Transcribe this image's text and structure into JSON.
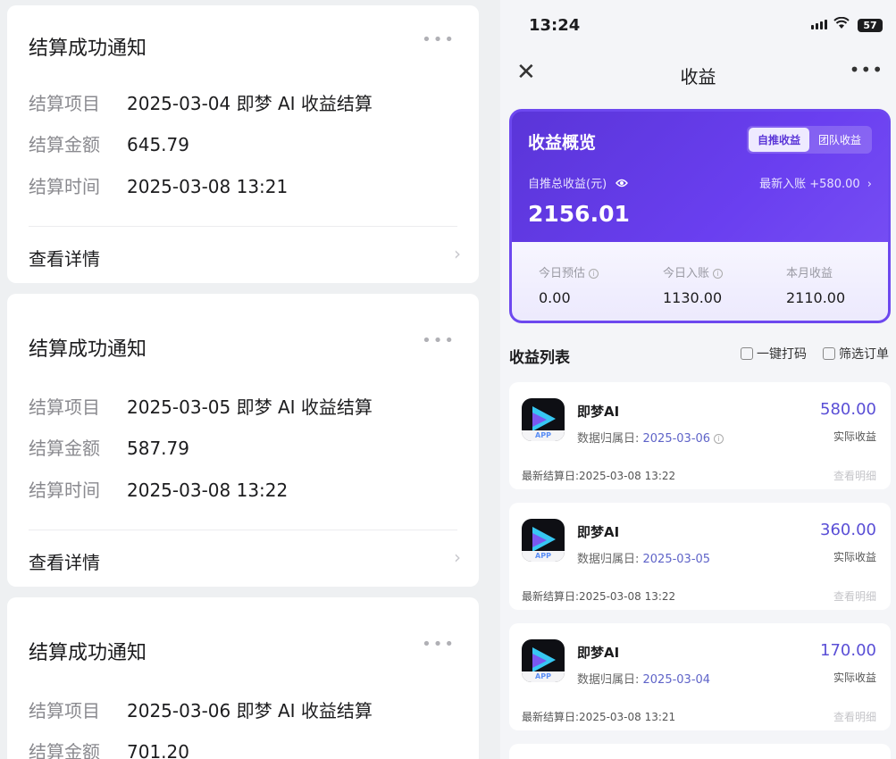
{
  "notifications": [
    {
      "title": "结算成功通知",
      "project_label": "结算项目",
      "project": "2025-03-04 即梦 AI 收益结算",
      "amount_label": "结算金额",
      "amount": "645.79",
      "time_label": "结算时间",
      "time": "2025-03-08 13:21",
      "detail": "查看详情"
    },
    {
      "title": "结算成功通知",
      "project_label": "结算项目",
      "project": "2025-03-05 即梦 AI 收益结算",
      "amount_label": "结算金额",
      "amount": "587.79",
      "time_label": "结算时间",
      "time": "2025-03-08 13:22",
      "detail": "查看详情"
    },
    {
      "title": "结算成功通知",
      "project_label": "结算项目",
      "project": "2025-03-06 即梦 AI 收益结算",
      "amount_label": "结算金额",
      "amount": "701.20"
    }
  ],
  "status_bar": {
    "time": "13:24",
    "battery": "57"
  },
  "navbar": {
    "title": "收益"
  },
  "summary": {
    "title": "收益概览",
    "tab_self": "自推收益",
    "tab_team": "团队收益",
    "total_label": "自推总收益(元)",
    "latest": "最新入账 +580.00",
    "total": "2156.01",
    "stats": [
      {
        "label": "今日预估",
        "value": "0.00"
      },
      {
        "label": "今日入账",
        "value": "1130.00"
      },
      {
        "label": "本月收益",
        "value": "2110.00"
      }
    ]
  },
  "list": {
    "title": "收益列表",
    "tool_print": "一键打码",
    "tool_filter": "筛选订单",
    "items": [
      {
        "name": "即梦AI",
        "date_label": "数据归属日: ",
        "date": "2025-03-06",
        "amount": "580.00",
        "sub": "实际收益",
        "settle": "最新结算日:2025-03-08 13:22",
        "view": "查看明细"
      },
      {
        "name": "即梦AI",
        "date_label": "数据归属日: ",
        "date": "2025-03-05",
        "amount": "360.00",
        "sub": "实际收益",
        "settle": "最新结算日:2025-03-08 13:22",
        "view": "查看明细"
      },
      {
        "name": "即梦AI",
        "date_label": "数据归属日: ",
        "date": "2025-03-04",
        "amount": "170.00",
        "sub": "实际收益",
        "settle": "最新结算日:2025-03-08 13:21",
        "view": "查看明细"
      }
    ],
    "app_tag": "APP"
  },
  "icons": {
    "more": "more-horizontal-icon",
    "chevron": "chevron-right-icon",
    "close": "close-icon",
    "eye": "eye-icon",
    "info": "info-icon",
    "signal": "signal-icon",
    "wifi": "wifi-icon",
    "battery": "battery-icon"
  },
  "colors": {
    "accent": "#5a35d8",
    "amount": "#5a4fd6",
    "date_link": "#5e63c8"
  }
}
